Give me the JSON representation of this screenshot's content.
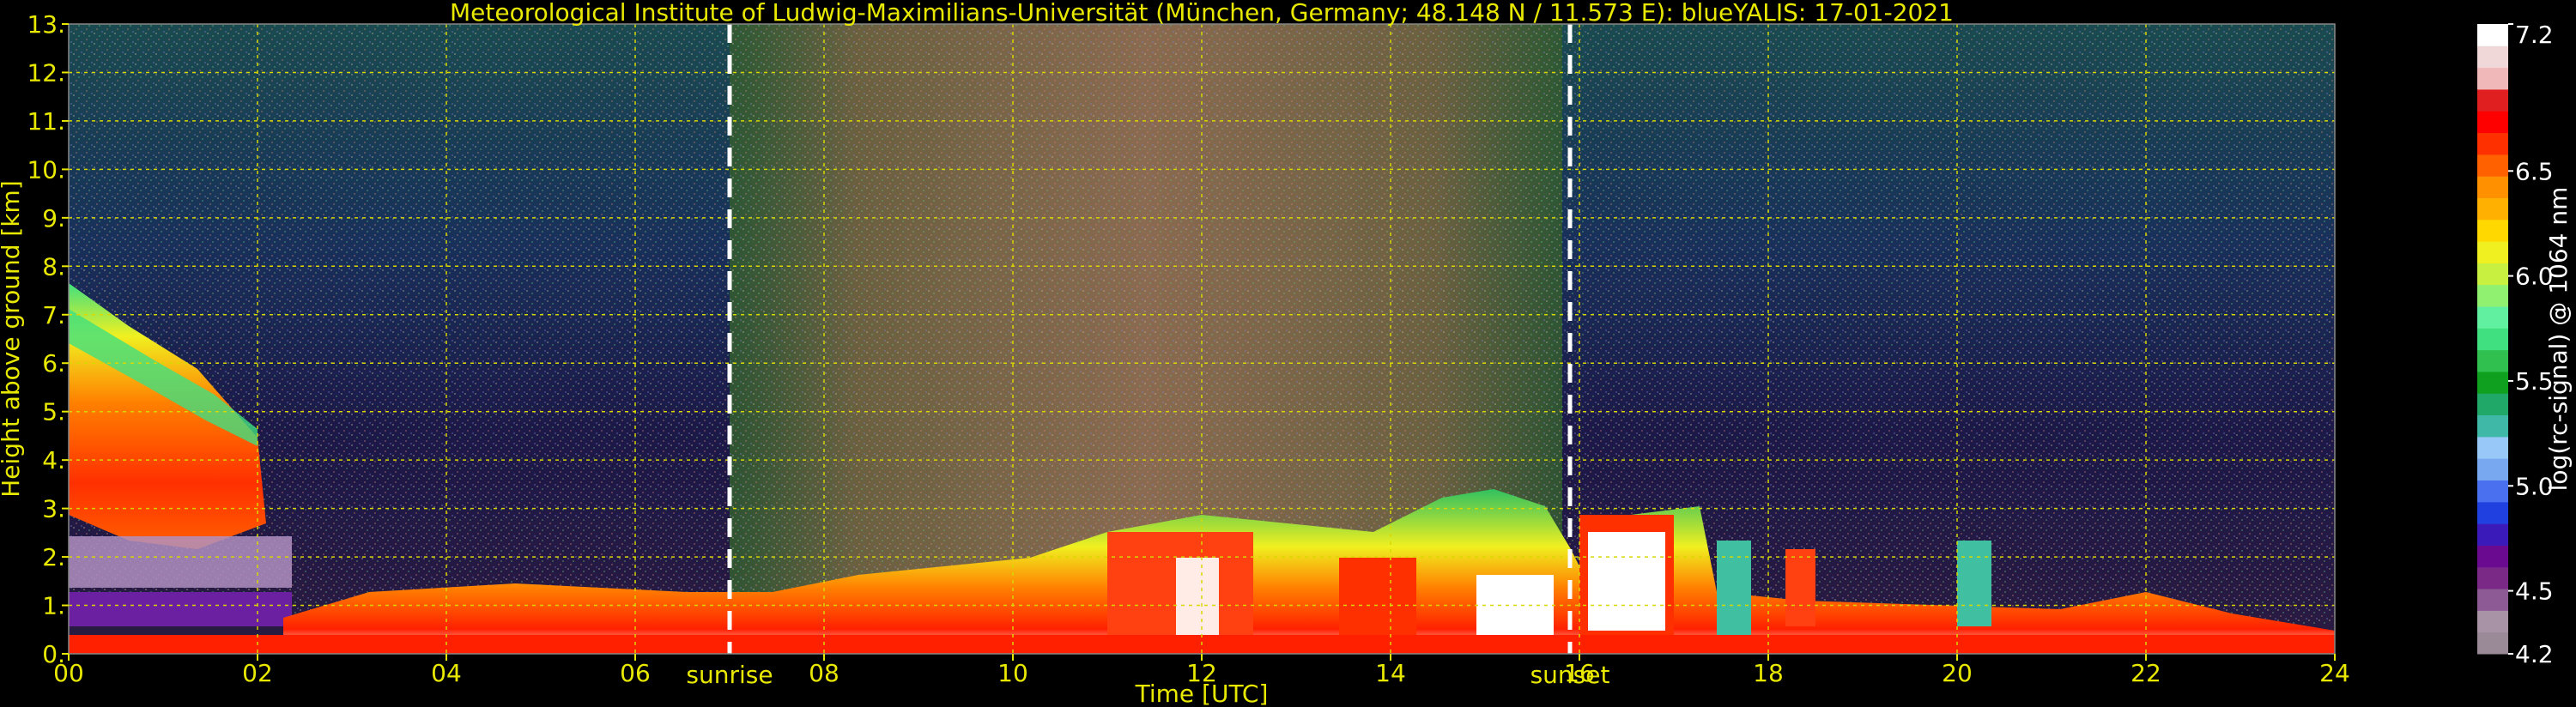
{
  "chart_data": {
    "type": "heatmap",
    "title": "Meteorological Institute of Ludwig-Maximilians-Universität (München, Germany; 48.148 N / 11.573 E):     blueYALIS: 17-01-2021",
    "xlabel": "Time [UTC]",
    "ylabel": "Height above ground [km]",
    "xlim": [
      0,
      24
    ],
    "ylim": [
      0,
      13
    ],
    "x_ticks": [
      "00",
      "02",
      "04",
      "06",
      "08",
      "10",
      "12",
      "14",
      "16",
      "18",
      "20",
      "22",
      "24"
    ],
    "y_ticks": [
      "0.",
      "1.",
      "2.",
      "3.",
      "4.",
      "5.",
      "6.",
      "7.",
      "8.",
      "9.",
      "10.",
      "11.",
      "12.",
      "13."
    ],
    "grid": true,
    "markers": [
      {
        "label": "sunrise",
        "x": 7.0
      },
      {
        "label": "sunset",
        "x": 15.9
      }
    ],
    "colorbar": {
      "label": "log(rc-signal) @ 1064 nm",
      "range": [
        4.2,
        7.2
      ],
      "ticks": [
        "4.2",
        "4.5",
        "5.0",
        "5.5",
        "6.0",
        "6.5",
        "7.2"
      ],
      "colors": [
        "#9a8a98",
        "#a892a6",
        "#8e5a96",
        "#7a2a86",
        "#6a0a90",
        "#3a1ab8",
        "#2040e0",
        "#4a70f0",
        "#78a8f0",
        "#98c8f8",
        "#40b8a8",
        "#20a868",
        "#10a020",
        "#30c050",
        "#40e080",
        "#60f0a0",
        "#90f070",
        "#c8f040",
        "#f0f020",
        "#ffd800",
        "#ffb000",
        "#ff9000",
        "#ff6000",
        "#ff3000",
        "#ff0000",
        "#e02020",
        "#f0b8b8",
        "#f0d8d8",
        "#ffffff"
      ],
      "position": "right"
    }
  }
}
